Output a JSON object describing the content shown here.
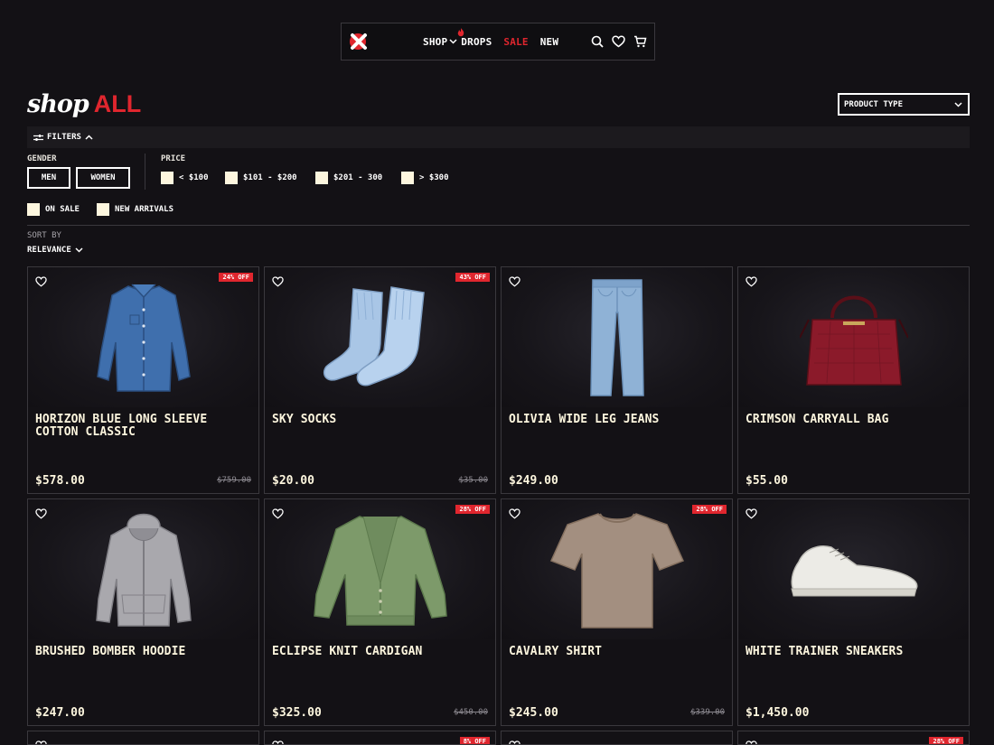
{
  "nav": {
    "links": [
      {
        "label": "SHOP"
      },
      {
        "label": "DROPS"
      },
      {
        "label": "SALE"
      },
      {
        "label": "NEW"
      }
    ],
    "accent": "#e0262e"
  },
  "heading": {
    "prefix": "shop",
    "emphasis": "ALL"
  },
  "product_type": {
    "label": "PRODUCT TYPE"
  },
  "filters": {
    "toggle_label": "FILTERS",
    "gender": {
      "label": "GENDER",
      "options": [
        "MEN",
        "WOMEN"
      ]
    },
    "price": {
      "label": "PRICE",
      "options": [
        "< $100",
        "$101 - $200",
        "$201 - 300",
        "> $300"
      ]
    },
    "extras": [
      "ON SALE",
      "NEW ARRIVALS"
    ]
  },
  "sort": {
    "label": "SORT BY",
    "value": "RELEVANCE"
  },
  "products": [
    {
      "name": "HORIZON BLUE LONG SLEEVE COTTON CLASSIC",
      "price": "$578.00",
      "was": "$759.00",
      "badge": "24% OFF",
      "icon": "shirt"
    },
    {
      "name": "SKY SOCKS",
      "price": "$20.00",
      "was": "$35.00",
      "badge": "43% OFF",
      "icon": "socks"
    },
    {
      "name": "OLIVIA WIDE LEG JEANS",
      "price": "$249.00",
      "was": "",
      "badge": "",
      "icon": "jeans"
    },
    {
      "name": "CRIMSON CARRYALL BAG",
      "price": "$55.00",
      "was": "",
      "badge": "",
      "icon": "bag"
    },
    {
      "name": "BRUSHED BOMBER HOODIE",
      "price": "$247.00",
      "was": "",
      "badge": "",
      "icon": "hoodie"
    },
    {
      "name": "ECLIPSE KNIT CARDIGAN",
      "price": "$325.00",
      "was": "$450.00",
      "badge": "28% OFF",
      "icon": "cardigan"
    },
    {
      "name": "CAVALRY SHIRT",
      "price": "$245.00",
      "was": "$339.00",
      "badge": "28% OFF",
      "icon": "tshirt"
    },
    {
      "name": "WHITE TRAINER SNEAKERS",
      "price": "$1,450.00",
      "was": "",
      "badge": "",
      "icon": "sneaker"
    }
  ],
  "partial_row_badges": [
    "",
    "8% OFF",
    "",
    "28% OFF"
  ]
}
